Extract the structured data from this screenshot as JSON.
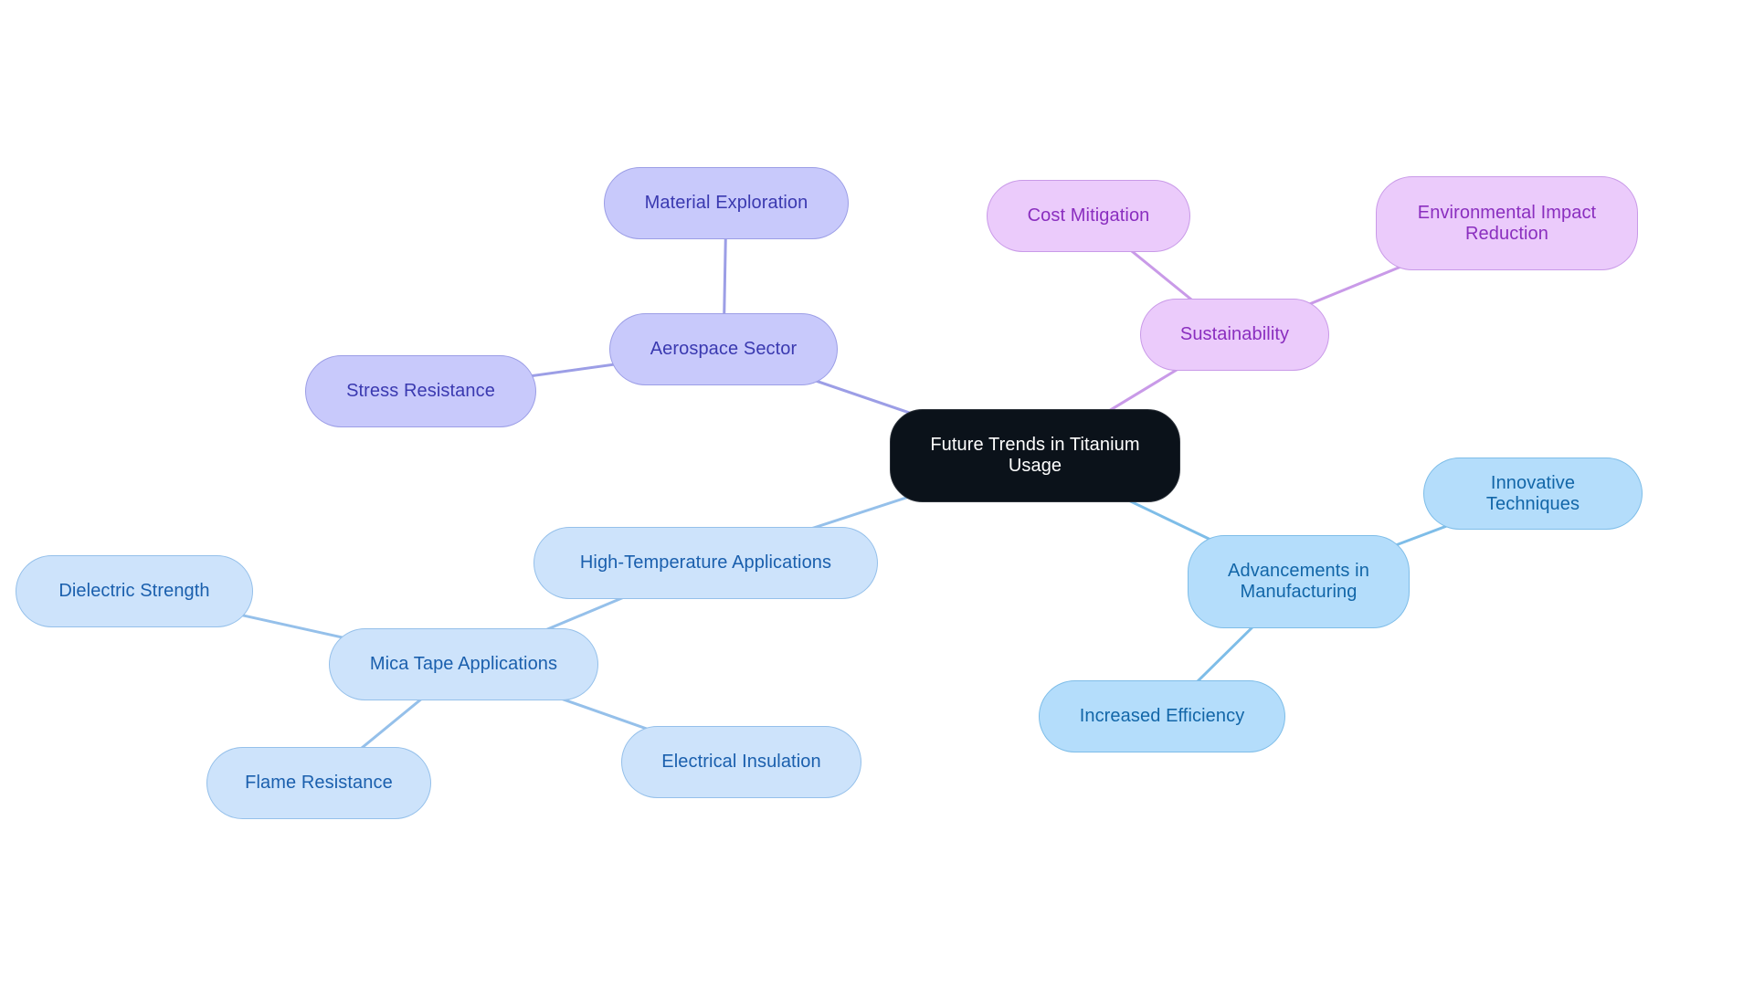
{
  "diagram": {
    "type": "mind-map",
    "root": {
      "id": "root",
      "label": "Future Trends in Titanium Usage",
      "theme": "root"
    },
    "branches": [
      {
        "id": "aero",
        "label": "Aerospace Sector",
        "theme": "aero",
        "children": [
          {
            "id": "aero-mat",
            "label": "Material Exploration"
          },
          {
            "id": "aero-stress",
            "label": "Stress Resistance"
          }
        ]
      },
      {
        "id": "sust",
        "label": "Sustainability",
        "theme": "sust",
        "children": [
          {
            "id": "sust-cost",
            "label": "Cost Mitigation"
          },
          {
            "id": "sust-env",
            "label": "Environmental Impact Reduction"
          }
        ]
      },
      {
        "id": "manu",
        "label": "Advancements in Manufacturing",
        "theme": "manu",
        "children": [
          {
            "id": "manu-innov",
            "label": "Innovative Techniques"
          },
          {
            "id": "manu-eff",
            "label": "Increased Efficiency"
          }
        ]
      },
      {
        "id": "temp",
        "label": "High-Temperature Applications",
        "theme": "temp",
        "children": [
          {
            "id": "mica",
            "label": "Mica Tape Applications",
            "children": [
              {
                "id": "mica-diel",
                "label": "Dielectric Strength"
              },
              {
                "id": "mica-flame",
                "label": "Flame Resistance"
              },
              {
                "id": "mica-elec",
                "label": "Electrical Insulation"
              }
            ]
          }
        ]
      }
    ]
  },
  "colors": {
    "root_fill": "#0b121a",
    "aero_line": "#9c9ee6",
    "sust_line": "#c99ae8",
    "manu_line": "#7ebde8",
    "temp_line": "#95c0ea"
  }
}
